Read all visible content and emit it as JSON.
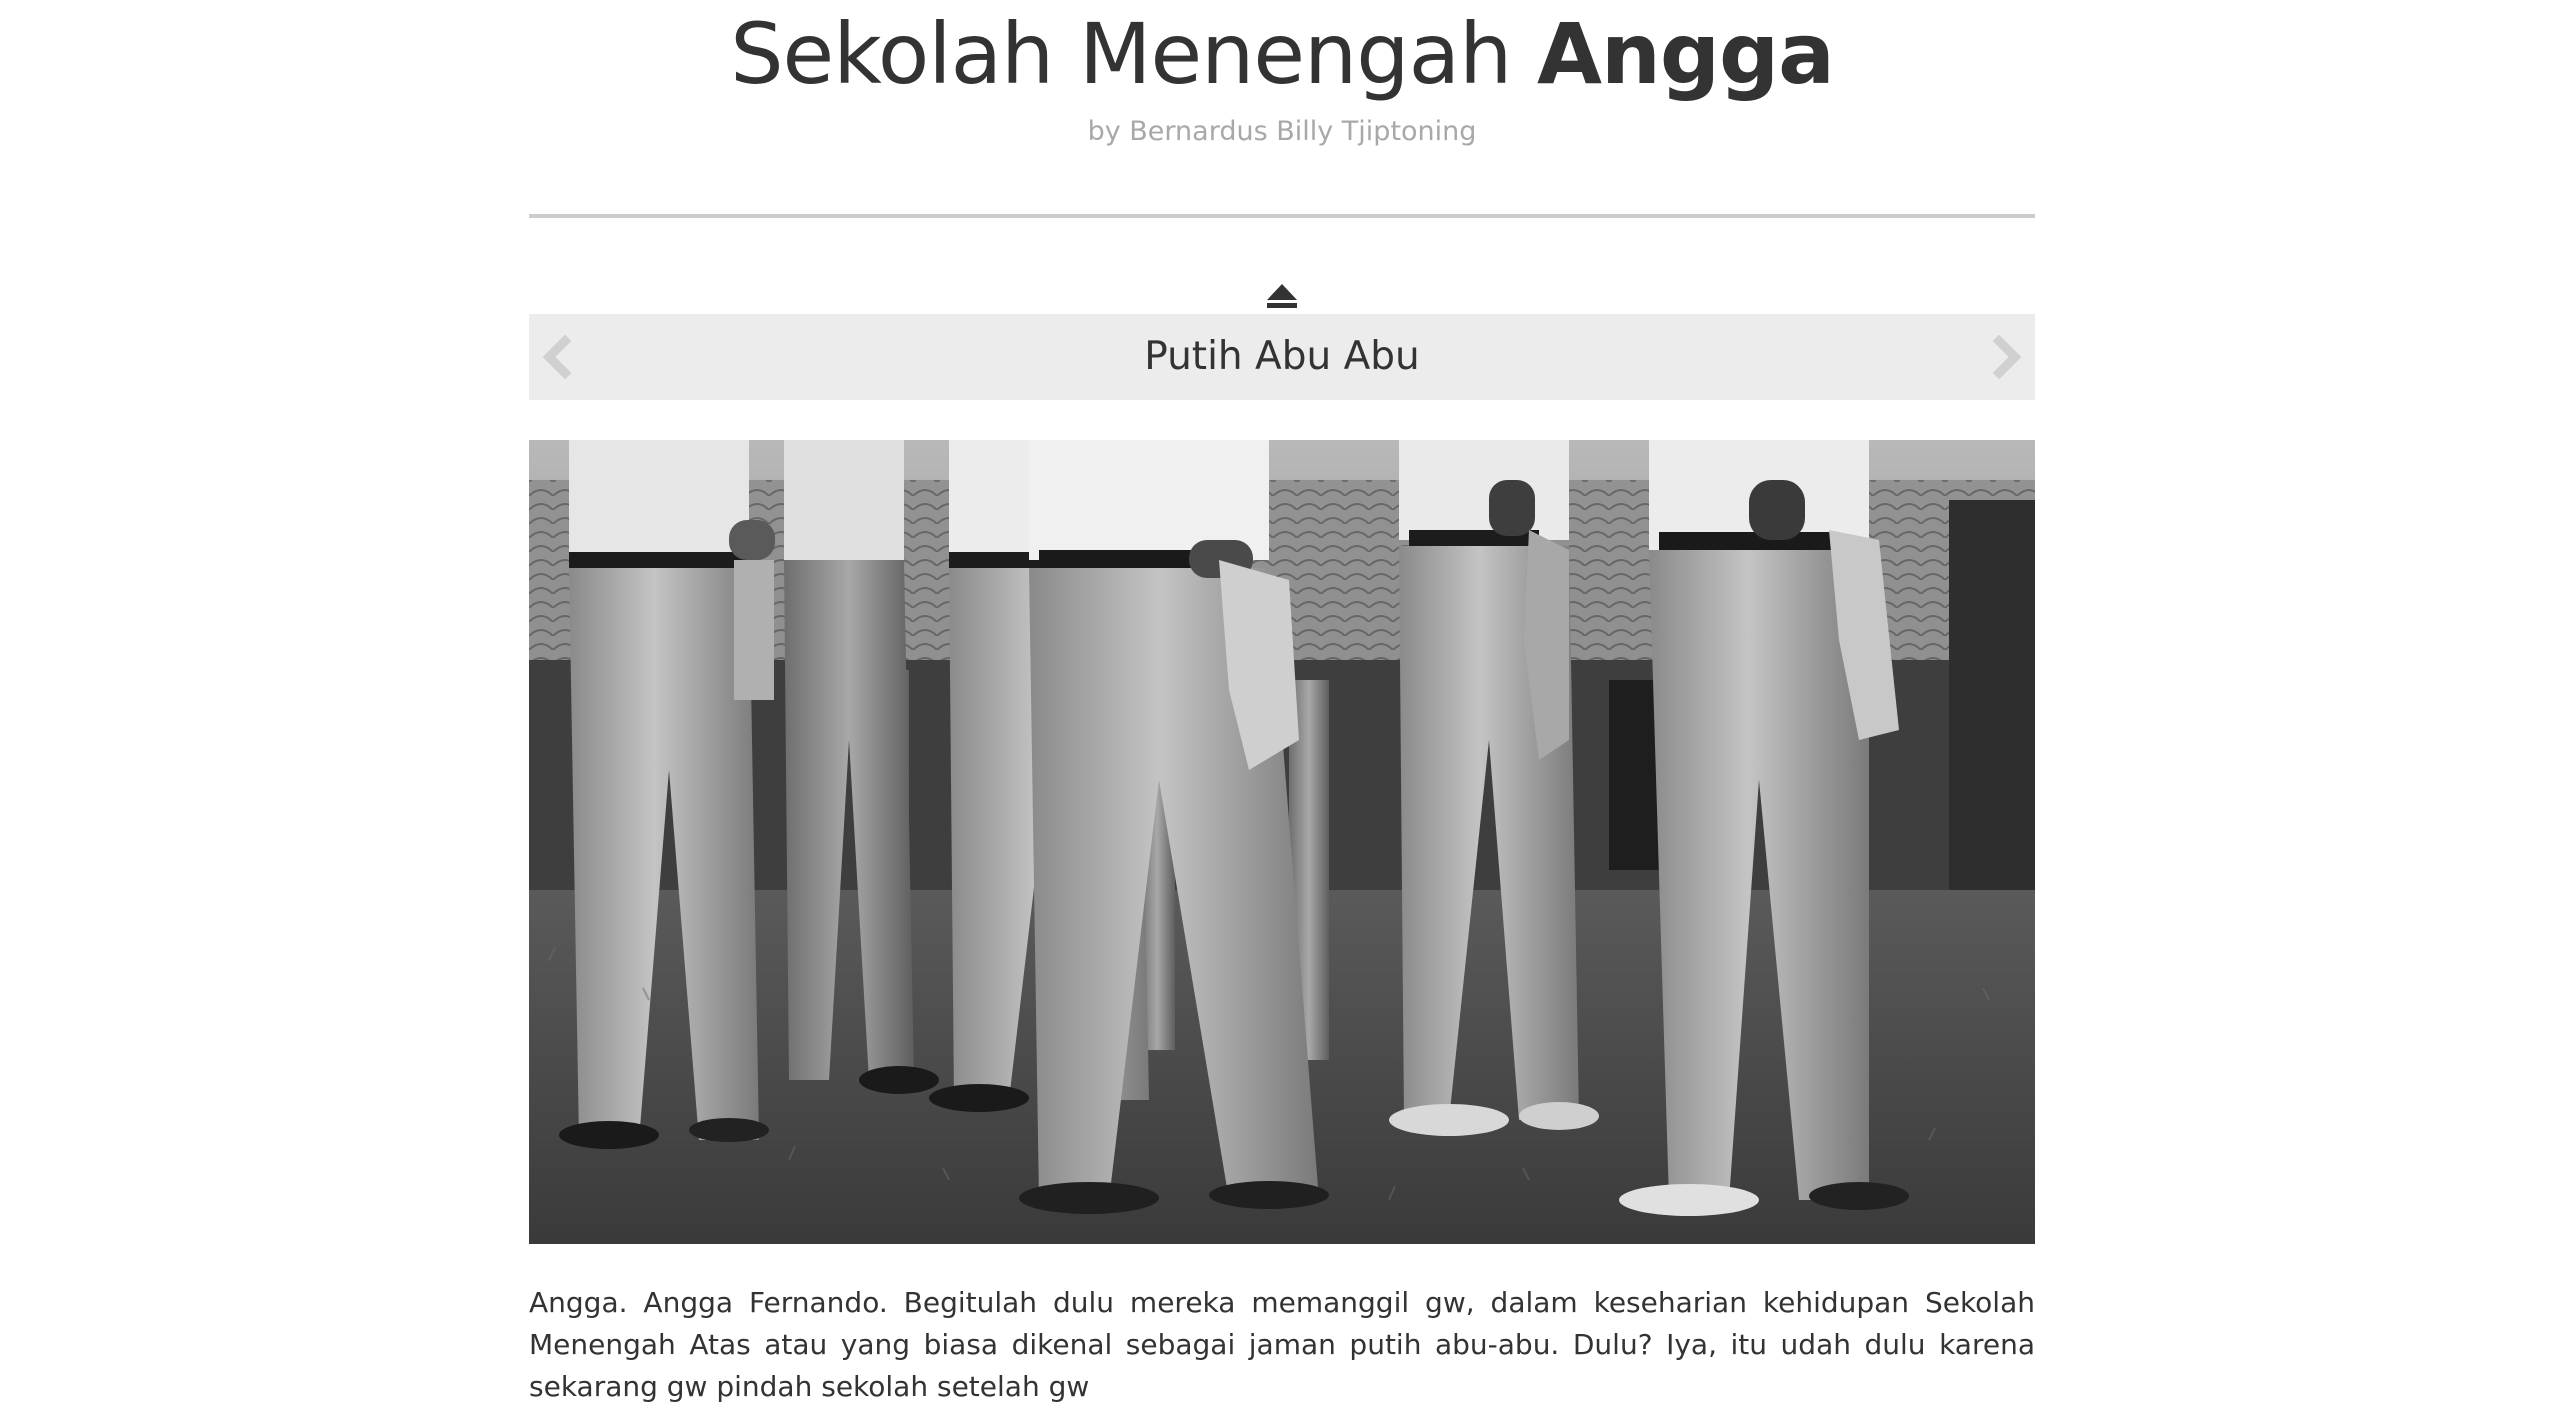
{
  "header": {
    "title_regular": "Sekolah Menengah ",
    "title_bold": "Angga",
    "byline": "by Bernardus Billy Tjiptoning"
  },
  "gallery": {
    "up_icon": "eject-icon",
    "caption": "Putih Abu Abu",
    "prev_icon": "chevron-left-icon",
    "next_icon": "chevron-right-icon",
    "photo_style": "black-and-white"
  },
  "article": {
    "paragraph": "Angga. Angga Fernando. Begitulah dulu mereka memanggil gw, dalam keseharian kehidupan Sekolah Menengah Atas atau yang biasa dikenal sebagai jaman putih abu-abu. Dulu? Iya, itu udah dulu karena sekarang gw pindah sekolah setelah gw"
  },
  "colors": {
    "text": "#333333",
    "byline": "#a8a8a8",
    "rule": "#cccccc",
    "nav_bg": "#ececec",
    "arrow": "#d0d0d0"
  }
}
